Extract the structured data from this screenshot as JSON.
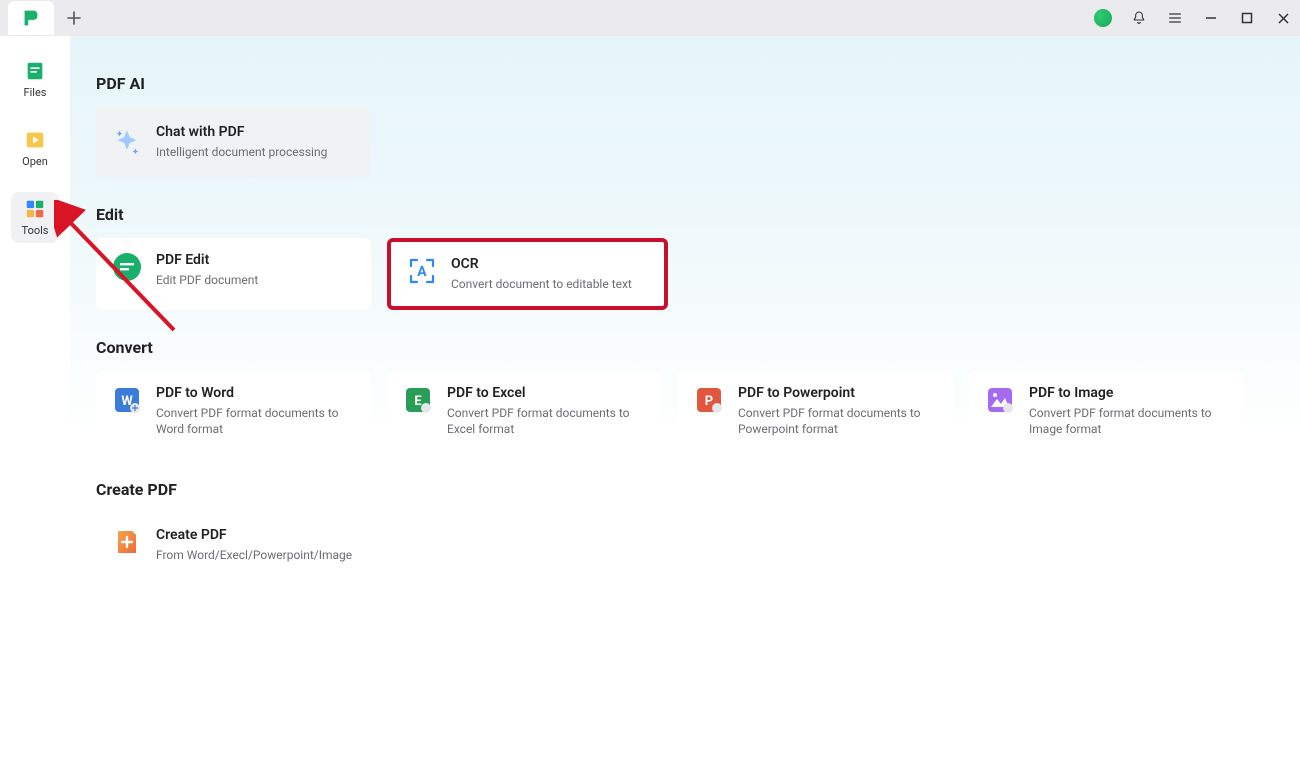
{
  "titlebar": {
    "new_tab_tooltip": "New Tab"
  },
  "window_controls": {
    "minimize": "minimize",
    "maximize": "maximize",
    "close": "close"
  },
  "sidebar": {
    "items": [
      {
        "label": "Files",
        "icon": "files"
      },
      {
        "label": "Open",
        "icon": "open"
      },
      {
        "label": "Tools",
        "icon": "tools"
      }
    ]
  },
  "sections": {
    "pdf_ai": {
      "title": "PDF AI",
      "card": {
        "title": "Chat with PDF",
        "desc": "Intelligent document processing"
      }
    },
    "edit": {
      "title": "Edit",
      "cards": [
        {
          "title": "PDF Edit",
          "desc": "Edit PDF document"
        },
        {
          "title": "OCR",
          "desc": "Convert document to editable text"
        }
      ]
    },
    "convert": {
      "title": "Convert",
      "cards": [
        {
          "title": "PDF to Word",
          "desc": "Convert PDF format documents to Word format"
        },
        {
          "title": "PDF to Excel",
          "desc": "Convert PDF format documents to Excel format"
        },
        {
          "title": "PDF to Powerpoint",
          "desc": "Convert PDF format documents to Powerpoint format"
        },
        {
          "title": "PDF to Image",
          "desc": "Convert PDF format documents to Image format"
        }
      ]
    },
    "create": {
      "title": "Create PDF",
      "card": {
        "title": "Create PDF",
        "desc": "From Word/Execl/Powerpoint/Image"
      }
    }
  },
  "annotations": {
    "highlight_target": "OCR",
    "arrow_target": "Tools"
  }
}
